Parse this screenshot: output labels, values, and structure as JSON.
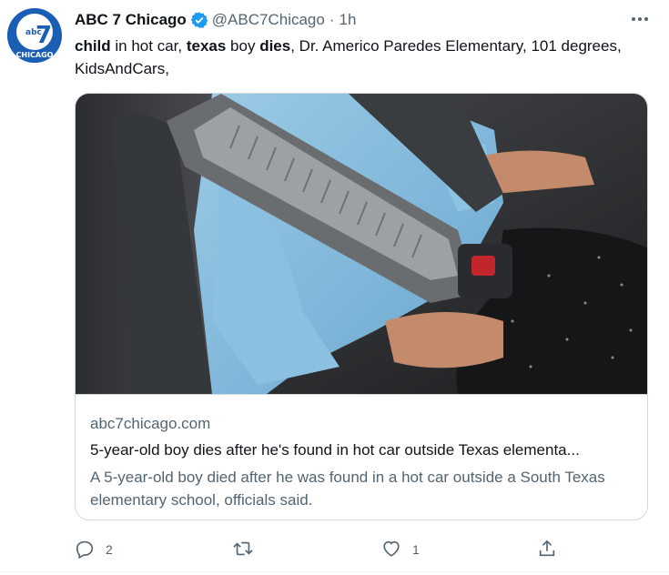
{
  "account": {
    "display_name": "ABC 7 Chicago",
    "handle": "@ABC7Chicago",
    "separator": "·",
    "time": "1h",
    "avatar_text": "abc",
    "avatar_number": "7",
    "avatar_city": "CHICAGO"
  },
  "tweet": {
    "segments": [
      {
        "text": "child",
        "bold": true
      },
      {
        "text": " in hot car, ",
        "bold": false
      },
      {
        "text": "texas",
        "bold": true
      },
      {
        "text": " boy ",
        "bold": false
      },
      {
        "text": "dies",
        "bold": true
      },
      {
        "text": ", Dr. Americo Paredes Elementary, 101 degrees, KidsAndCars,",
        "bold": false
      }
    ]
  },
  "card": {
    "domain": "abc7chicago.com",
    "title": "5-year-old boy dies after he's found in hot car outside Texas elementa...",
    "description": "A 5-year-old boy died after he was found in a hot car outside a South Texas elementary school, officials said."
  },
  "actions": {
    "reply_count": "2",
    "retweet_count": "",
    "like_count": "1"
  },
  "icons": {
    "verified": "verified-badge-icon",
    "more": "more-icon",
    "reply": "reply-icon",
    "retweet": "retweet-icon",
    "like": "like-icon",
    "share": "share-icon"
  },
  "colors": {
    "verified": "#1d9bf0",
    "text_primary": "#0f1419",
    "text_secondary": "#536471",
    "border": "#cfd9de",
    "avatar_bg": "#1a5fb4"
  }
}
